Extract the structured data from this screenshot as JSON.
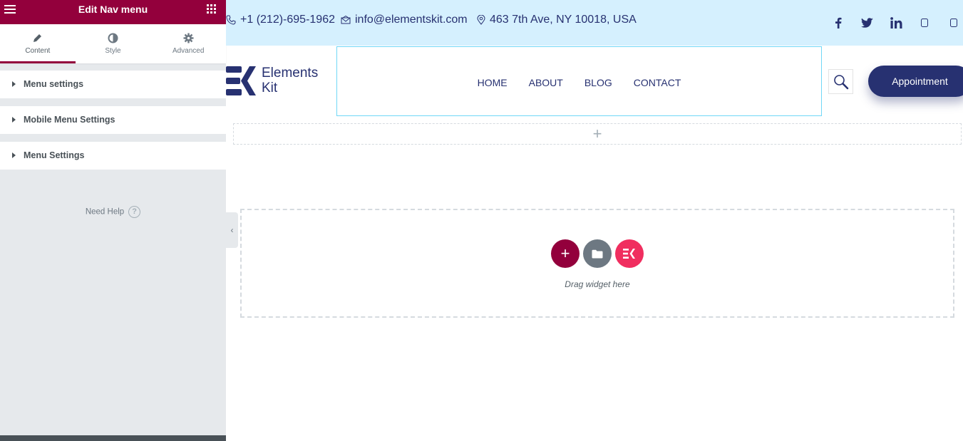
{
  "panel": {
    "title": "Edit Nav menu",
    "tabs": [
      {
        "label": "Content",
        "icon": "pencil-icon",
        "active": true
      },
      {
        "label": "Style",
        "icon": "half-circle-icon",
        "active": false
      },
      {
        "label": "Advanced",
        "icon": "gear-icon",
        "active": false
      }
    ],
    "sections": [
      {
        "label": "Menu settings"
      },
      {
        "label": "Mobile Menu Settings"
      },
      {
        "label": "Menu Settings"
      }
    ],
    "help_label": "Need Help",
    "help_icon_glyph": "?",
    "collapse_glyph": "‹",
    "accent": "#93003c"
  },
  "topbar": {
    "phone": "+1 (212)-695-1962",
    "email": "info@elementskit.com",
    "address": "463 7th Ave, NY 10018, USA",
    "background": "#d5f0fe",
    "social": [
      "facebook-icon",
      "twitter-icon",
      "linkedin-icon",
      "square-icon",
      "square-icon"
    ]
  },
  "header": {
    "logo_line1": "Elements",
    "logo_line2": "Kit",
    "menu": [
      "HOME",
      "ABOUT",
      "BLOG",
      "CONTACT"
    ],
    "cta_label": "Appointment",
    "brand_color": "#273171"
  },
  "canvas": {
    "add_section_glyph": "+",
    "drop_hint": "Drag widget here",
    "add_button_glyph": "+"
  }
}
